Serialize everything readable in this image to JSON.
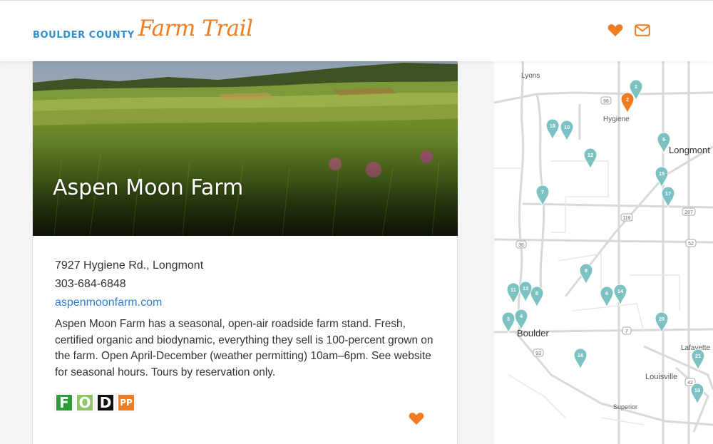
{
  "header": {
    "logo_county": "BOULDER COUNTY",
    "logo_trail": "Farm Trail",
    "favorites_icon": "heart-icon",
    "contact_icon": "envelope-icon"
  },
  "farm": {
    "name": "Aspen Moon Farm",
    "address": "7927 Hygiene Rd., Longmont",
    "phone": "303-684-6848",
    "website": "aspenmoonfarm.com",
    "description": "Aspen Moon Farm has a seasonal, open-air roadside farm stand. Fresh, certified organic and biodynamic, everything they sell is 100-percent grown on the farm. Open April-December (weather permitting) 10am–6pm. See website for seasonal hours. Tours by reservation only.",
    "badges": [
      "F",
      "O",
      "D",
      "PP"
    ],
    "favorite_icon": "heart-icon"
  },
  "map": {
    "towns": [
      "Lyons",
      "Hygiene",
      "Longmont",
      "Boulder",
      "Lafayette",
      "Louisville",
      "Superior"
    ],
    "routes": [
      "66",
      "119",
      "287",
      "36",
      "52",
      "7",
      "93",
      "42"
    ],
    "markers": [
      "1",
      "2",
      "3",
      "4",
      "5",
      "6",
      "7",
      "8",
      "9",
      "10",
      "11",
      "12",
      "13",
      "14",
      "15",
      "16",
      "17",
      "18",
      "19",
      "20",
      "21"
    ],
    "selected_marker": "2",
    "colors": {
      "marker": "#7cc2c2",
      "selected": "#f07c22"
    }
  },
  "colors": {
    "accent": "#f07c22",
    "brand_blue": "#2f8fcf",
    "link": "#2f7fd3"
  }
}
